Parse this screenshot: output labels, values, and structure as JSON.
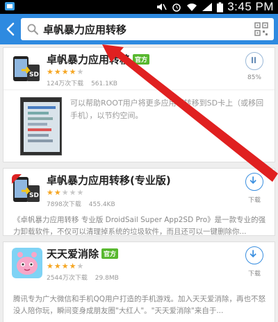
{
  "status_bar": {
    "time": "3:45 PM",
    "icons": [
      "notification-icon",
      "mute-icon",
      "alarm-icon",
      "wifi-icon",
      "signal-icon",
      "battery-icon"
    ]
  },
  "search": {
    "query": "卓帆暴力应用转移",
    "icons": [
      "back-arrow-icon",
      "search-icon",
      "qr-scan-icon"
    ]
  },
  "results": [
    {
      "name": "卓帆暴力应用转移",
      "badge": "官方",
      "rating": 4,
      "downloads": "124万次下载",
      "size": "561.1KB",
      "action": "85%",
      "action_type": "pause",
      "description": "可以帮助ROOT用户将更多应用（转移到SD卡上（或移回手机），以节约空间。"
    },
    {
      "name": "卓帆暴力应用转移(专业版)",
      "rating": 2,
      "downloads": "7898次下载",
      "size": "455.4KB",
      "action": "下载",
      "action_type": "download",
      "description": "《卓帆暴力应用转移 专业版 DroidSail Super App2SD Pro》是一款专业的强力卸载软件，不仅可以清理掉系统的垃圾软件，而且还可以一键删除你..."
    },
    {
      "name": "天天爱消除",
      "badge": "官方",
      "rating": 4,
      "downloads": "2544万次下载",
      "size": "29.8MB",
      "action": "下载",
      "action_type": "download",
      "description": "腾讯专为广大微信和手机QQ用户打造的手机游戏。加入天天爱消除，再也不怒没人陪你玩，瞬间变身成朋友圈\"大红人\"。\"天天爱消除\"来自于..."
    }
  ],
  "colors": {
    "header": "#2e8ae0",
    "accent": "#3a8fe0",
    "official_badge": "#58b82f",
    "star": "#f5a623",
    "annotation_arrow": "#e02020"
  }
}
